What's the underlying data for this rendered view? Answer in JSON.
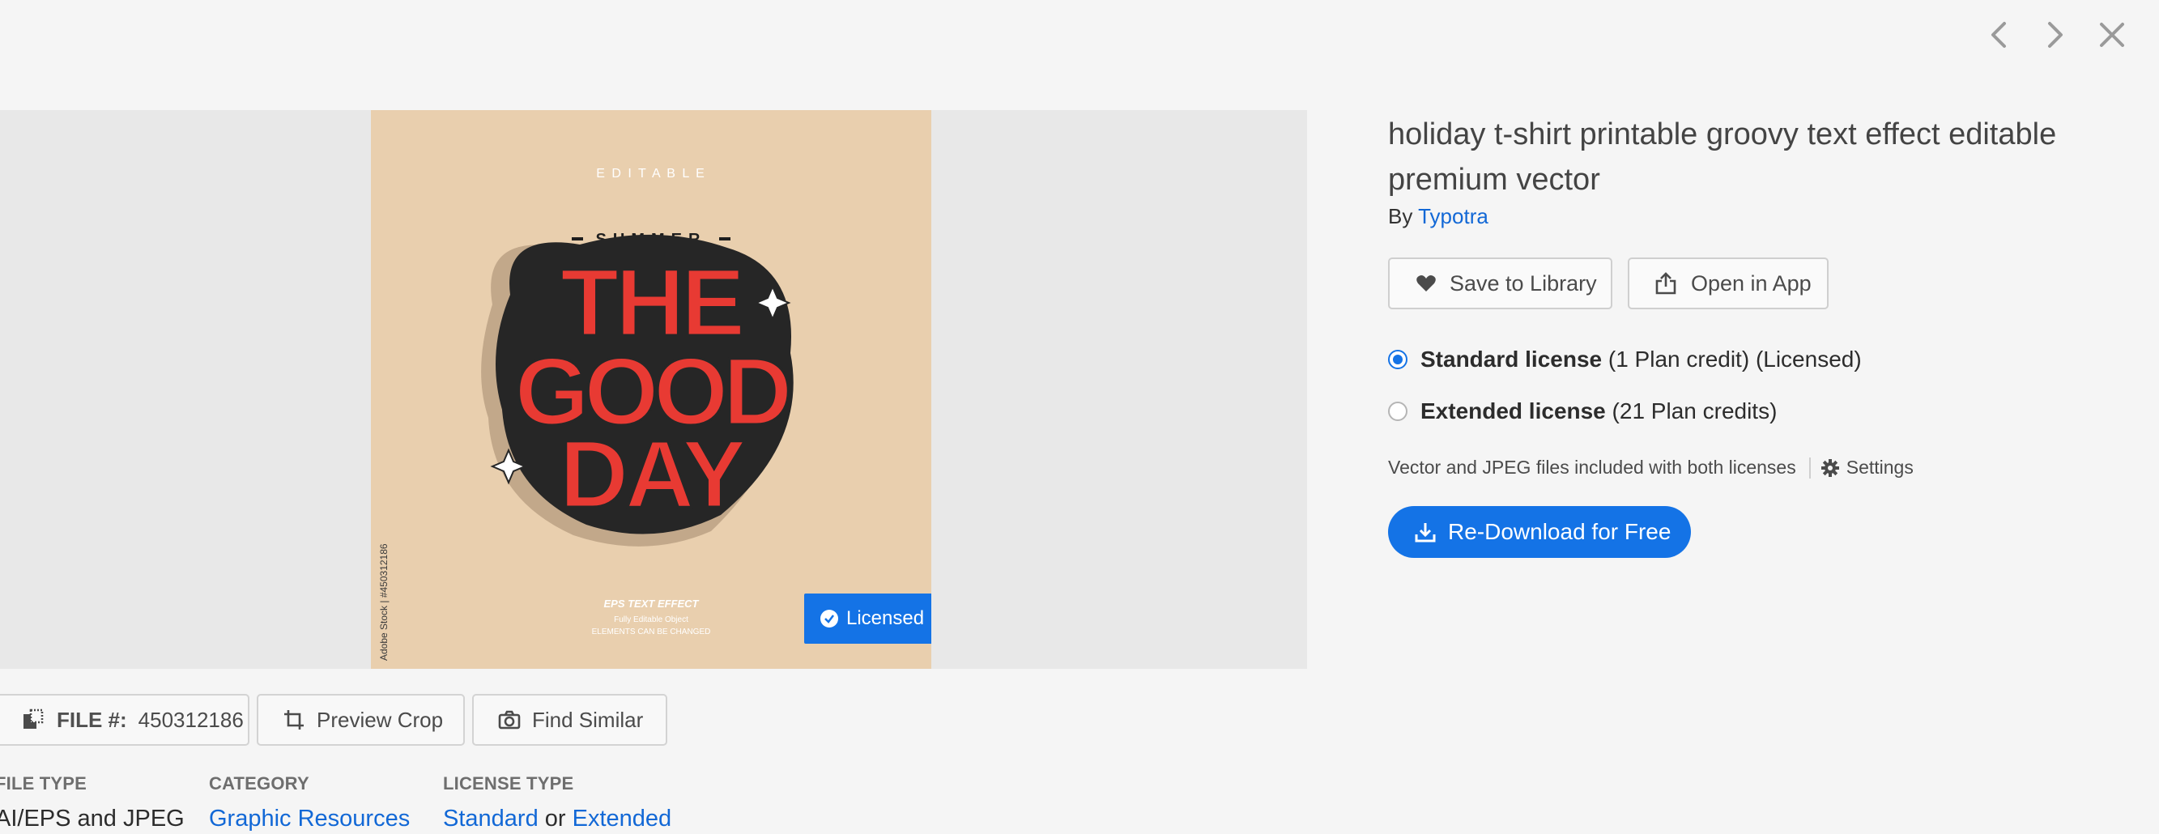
{
  "nav": {
    "prev": "chevron-left-icon",
    "next": "chevron-right-icon",
    "close": "close-icon"
  },
  "artwork": {
    "editable": "E D I T A B L E",
    "summer": "SUMMER",
    "line1": "THE",
    "line2": "GOOD",
    "line3": "DAY",
    "footer_title": "EPS TEXT EFFECT",
    "footer_sub1": "Fully Editable Object",
    "footer_sub2": "ELEMENTS CAN BE CHANGED",
    "watermark": "Adobe Stock | #450312186",
    "badge": "Licensed"
  },
  "tools": {
    "file_label": "FILE #:",
    "file_number": "450312186",
    "preview_crop": "Preview Crop",
    "find_similar": "Find Similar"
  },
  "meta": {
    "file_type_label": "FILE TYPE",
    "file_type_value": "AI/EPS and JPEG",
    "category_label": "CATEGORY",
    "category_value": "Graphic Resources",
    "license_type_label": "LICENSE TYPE",
    "license_standard": "Standard",
    "license_or": "or",
    "license_extended": "Extended"
  },
  "asset": {
    "title": "holiday t-shirt printable groovy text effect editable premium vector",
    "by": "By",
    "author": "Typotra"
  },
  "actions": {
    "save": "Save to Library",
    "open": "Open in App",
    "download": "Re-Download for Free"
  },
  "licenses": {
    "standard_name": "Standard license",
    "standard_detail": "(1 Plan credit) (Licensed)",
    "standard_selected": true,
    "extended_name": "Extended license",
    "extended_detail": "(21 Plan credits)",
    "extended_selected": false
  },
  "note": {
    "text": "Vector and JPEG files included with both licenses",
    "settings": "Settings"
  },
  "colors": {
    "accent": "#1473e6",
    "link": "#1268d6",
    "art_bg": "#e9cfae",
    "art_red": "#e83a33"
  }
}
